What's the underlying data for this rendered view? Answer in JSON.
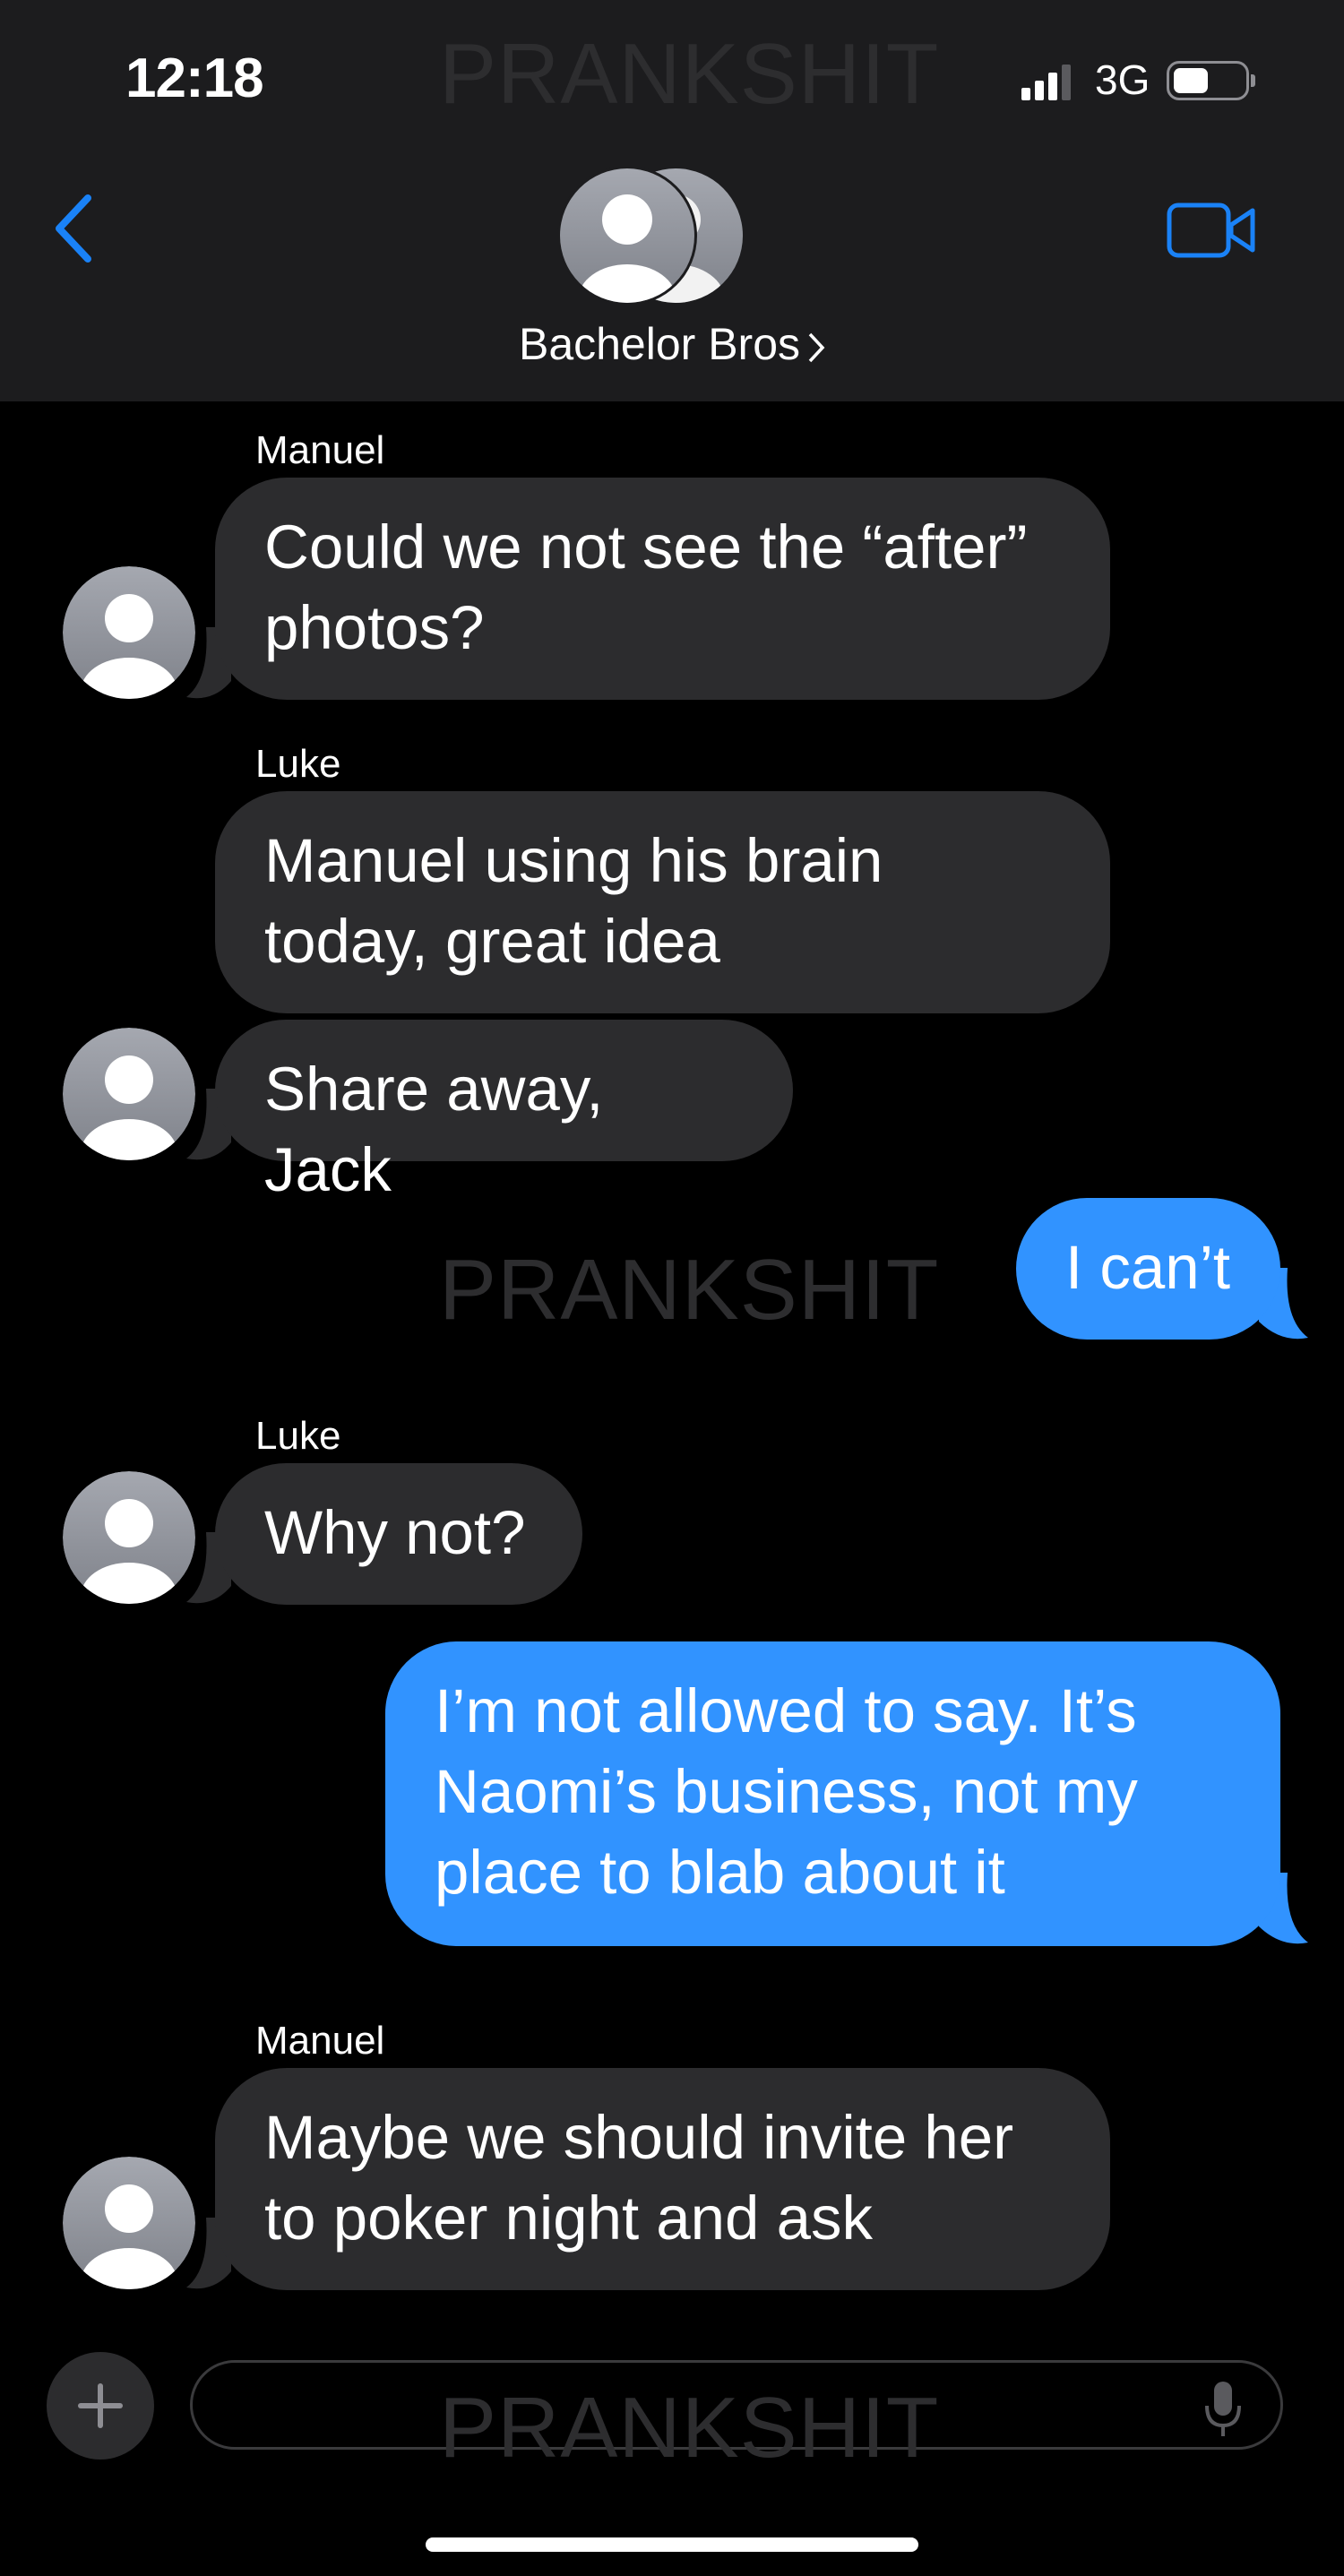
{
  "status_bar": {
    "time": "12:18",
    "network": "3G"
  },
  "header": {
    "group_name": "Bachelor Bros"
  },
  "watermark": "PRANKSHIT",
  "messages": [
    {
      "sender": "Manuel",
      "text": "Could we not see the “after” photos?",
      "direction": "incoming"
    },
    {
      "sender": "Luke",
      "text": "Manuel using his brain today, great idea",
      "direction": "incoming"
    },
    {
      "sender": "",
      "text": "Share away, Jack",
      "direction": "incoming"
    },
    {
      "sender": "",
      "text": "I can’t",
      "direction": "outgoing"
    },
    {
      "sender": "Luke",
      "text": "Why not?",
      "direction": "incoming"
    },
    {
      "sender": "",
      "text": "I’m not allowed to say. It’s Naomi’s business, not my place to blab about it",
      "direction": "outgoing"
    },
    {
      "sender": "Manuel",
      "text": "Maybe we should invite her to poker night and ask",
      "direction": "incoming"
    }
  ],
  "input": {
    "value": "",
    "placeholder": ""
  },
  "icons": [
    "back-chevron-icon",
    "video-camera-icon",
    "group-avatar-icon",
    "plus-icon",
    "microphone-icon",
    "signal-icon",
    "battery-icon"
  ],
  "colors": {
    "outgoing_bubble": "#3193ff",
    "incoming_bubble": "#2c2c2e",
    "accent": "#1a82f7",
    "header_bg": "#1c1c1e"
  }
}
